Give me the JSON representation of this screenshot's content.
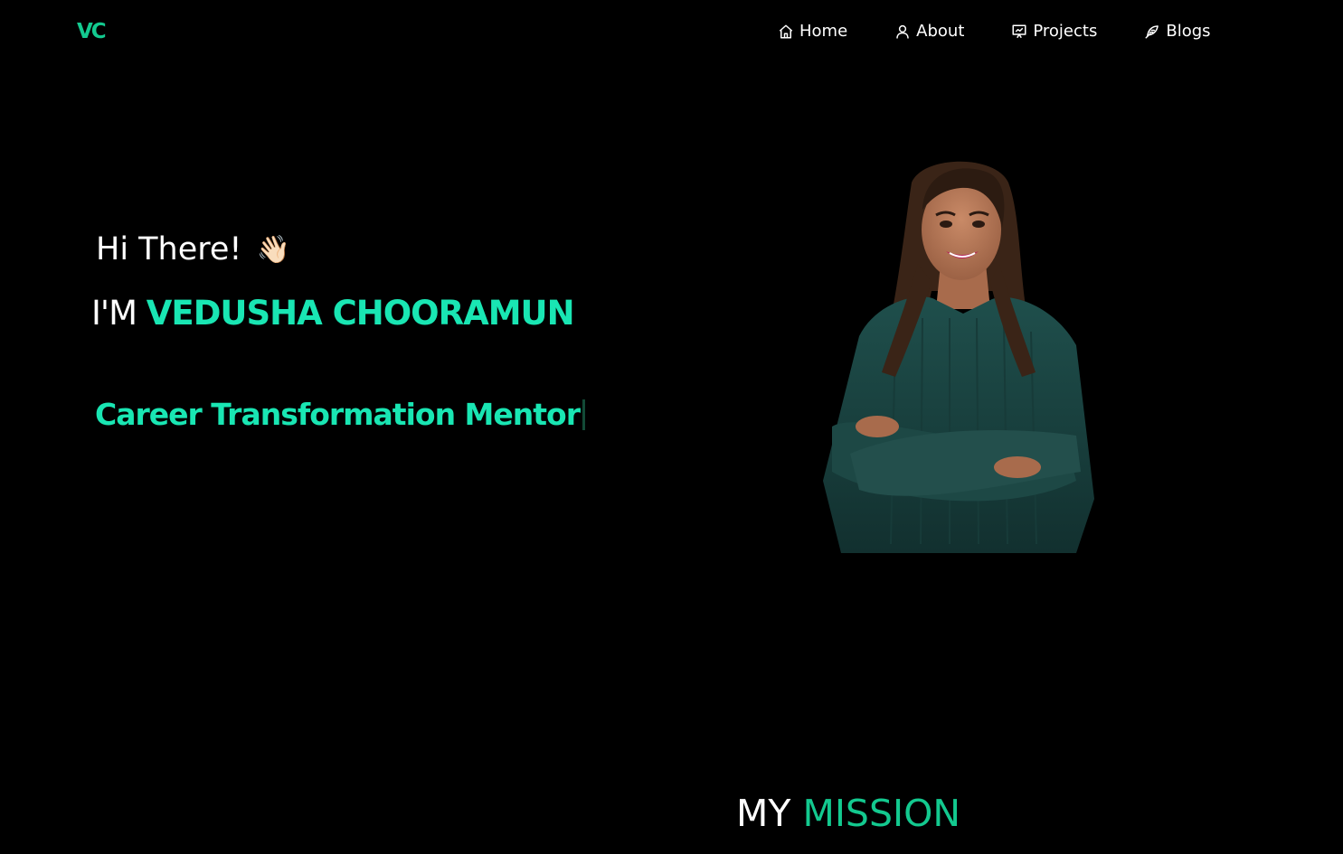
{
  "logo": "VC",
  "nav": {
    "home": "Home",
    "about": "About",
    "projects": "Projects",
    "blogs": "Blogs"
  },
  "hero": {
    "greeting": "Hi There!",
    "wave_emoji": "👋🏻",
    "intro_prefix": "I'M",
    "name": "VEDUSHA CHOORAMUN",
    "role": "Career Transformation Mentor"
  },
  "mission": {
    "word1": "MY",
    "word2": "MISSION"
  },
  "colors": {
    "background": "#000000",
    "accent": "#19e6b3",
    "accent_dark": "#13c98f",
    "text": "#ffffff"
  },
  "icons": {
    "home": "house-icon",
    "about": "user-icon",
    "projects": "presentation-icon",
    "blogs": "feather-icon"
  }
}
